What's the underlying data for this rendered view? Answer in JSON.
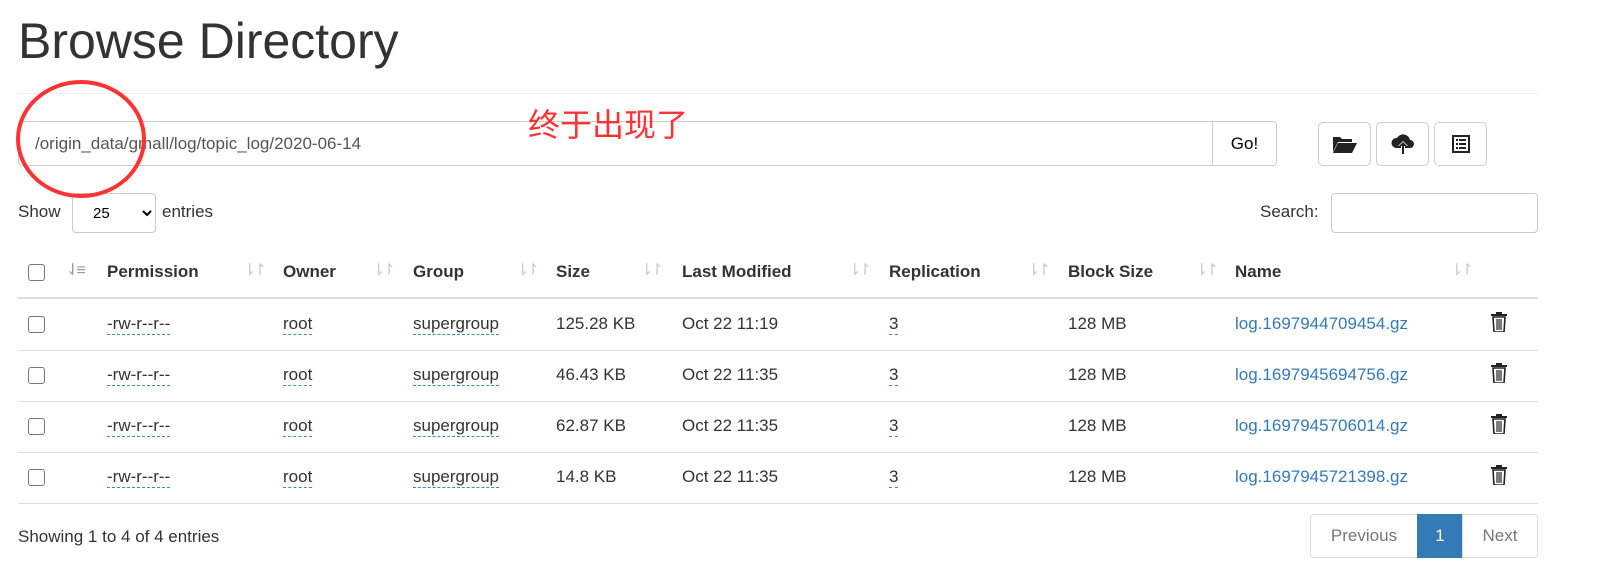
{
  "title": "Browse Directory",
  "path_value": "/origin_data/gmall/log/topic_log/2020-06-14",
  "go_label": "Go!",
  "toolbar": {
    "icons": [
      "folder-open-icon",
      "cloud-upload-icon",
      "list-icon"
    ]
  },
  "show_label": "Show",
  "entries_value": "25",
  "entries_label": "entries",
  "search_label": "Search:",
  "search_value": "",
  "columns": [
    "Permission",
    "Owner",
    "Group",
    "Size",
    "Last Modified",
    "Replication",
    "Block Size",
    "Name"
  ],
  "rows": [
    [
      "-rw-r--r--",
      "root",
      "supergroup",
      "125.28 KB",
      "Oct 22 11:19",
      "3",
      "128 MB",
      "log.1697944709454.gz"
    ],
    [
      "-rw-r--r--",
      "root",
      "supergroup",
      "46.43 KB",
      "Oct 22 11:35",
      "3",
      "128 MB",
      "log.1697945694756.gz"
    ],
    [
      "-rw-r--r--",
      "root",
      "supergroup",
      "62.87 KB",
      "Oct 22 11:35",
      "3",
      "128 MB",
      "log.1697945706014.gz"
    ],
    [
      "-rw-r--r--",
      "root",
      "supergroup",
      "14.8 KB",
      "Oct 22 11:35",
      "3",
      "128 MB",
      "log.1697945721398.gz"
    ]
  ],
  "footer": {
    "info": "Showing 1 to 4 of 4 entries",
    "previous": "Previous",
    "page": "1",
    "next": "Next"
  },
  "annotation": {
    "text": "终于出现了",
    "color": "#ff3333"
  },
  "colors": {
    "link": "#337ab7",
    "active_page": "#337ab7"
  }
}
